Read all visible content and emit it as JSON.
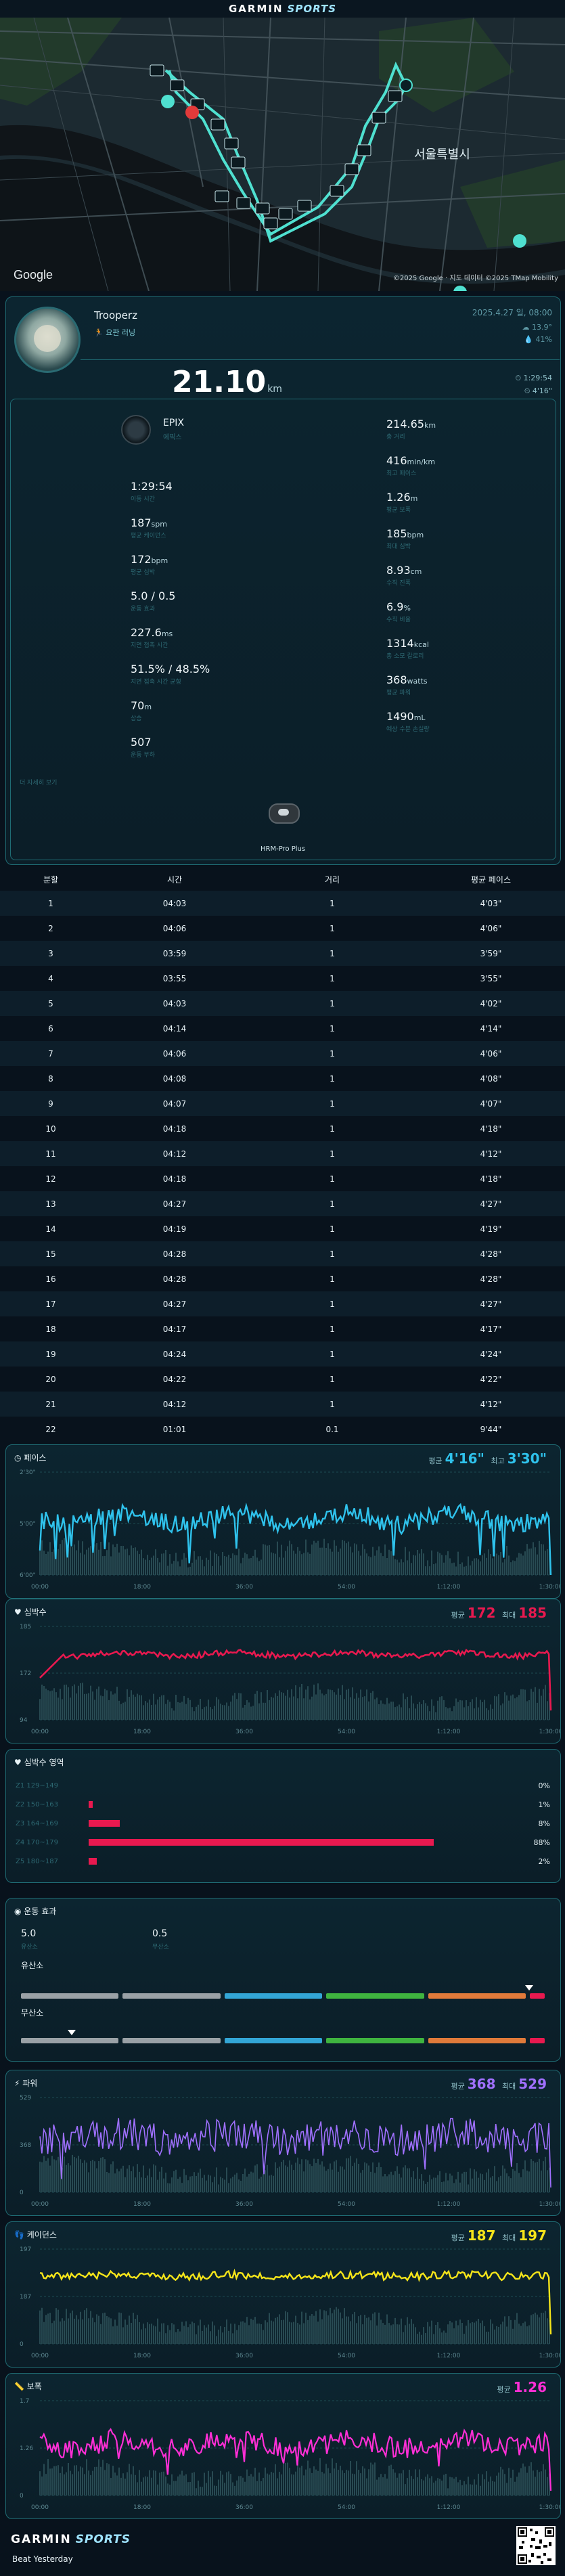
{
  "header": {
    "brand": "GARMIN",
    "sub_brand": "SPORTS"
  },
  "map": {
    "google_label": "Google",
    "attribution": "©2025 Google · 지도 데이터 ©2025 TMap Mobility",
    "city_label": "서울특별시",
    "km_markers": [
      "19",
      "20",
      "18",
      "17",
      "16",
      "15",
      "14",
      "13",
      "12",
      "11",
      "10",
      "9",
      "8",
      "7",
      "6",
      "5",
      "4",
      "3",
      "2",
      "1"
    ],
    "route_color": "#4fe0d0"
  },
  "profile": {
    "user_name": "Trooperz",
    "activity_name": "🏃 요판 러닝",
    "date": "2025.4.27 일, 08:00",
    "temperature": "13.9°",
    "humidity": "41%",
    "distance_value": "21.10",
    "distance_unit": "km",
    "total_time": "1:29:54",
    "avg_pace": "4'16\""
  },
  "device": {
    "name": "EPIX",
    "sub": "에픽스"
  },
  "stats": {
    "left": [
      {
        "value": "1:29:54",
        "unit": "",
        "label": "이동 시간"
      },
      {
        "value": "187",
        "unit": "spm",
        "label": "평균 케이던스"
      },
      {
        "value": "172",
        "unit": "bpm",
        "label": "평균 심박"
      },
      {
        "value": "5.0 / 0.5",
        "unit": "",
        "label": "운동 효과"
      },
      {
        "value": "227.6",
        "unit": "ms",
        "label": "지면 접촉 시간"
      },
      {
        "value": "51.5% / 48.5%",
        "unit": "",
        "label": "지면 접촉 시간 균형"
      },
      {
        "value": "70",
        "unit": "m",
        "label": "상승"
      },
      {
        "value": "507",
        "unit": "",
        "label": "운동 부하"
      }
    ],
    "right": [
      {
        "value": "214.65",
        "unit": "km",
        "label": "총 거리"
      },
      {
        "value": "416",
        "unit": "min/km",
        "label": "최고 페이스"
      },
      {
        "value": "1.26",
        "unit": "m",
        "label": "평균 보폭"
      },
      {
        "value": "185",
        "unit": "bpm",
        "label": "최대 심박"
      },
      {
        "value": "8.93",
        "unit": "cm",
        "label": "수직 진폭"
      },
      {
        "value": "6.9",
        "unit": "%",
        "label": "수직 비율"
      },
      {
        "value": "1314",
        "unit": "kcal",
        "label": "총 소모 칼로리"
      },
      {
        "value": "368",
        "unit": "watts",
        "label": "평균 파워"
      },
      {
        "value": "1490",
        "unit": "mL",
        "label": "예상 수분 손실량"
      }
    ],
    "more_label": "더 자세히 보기",
    "sensor_name": "HRM-Pro Plus"
  },
  "splits": {
    "headers": [
      "분할",
      "시간",
      "거리",
      "평균 페이스"
    ],
    "rows": [
      [
        "1",
        "04:03",
        "1",
        "4'03\""
      ],
      [
        "2",
        "04:06",
        "1",
        "4'06\""
      ],
      [
        "3",
        "03:59",
        "1",
        "3'59\""
      ],
      [
        "4",
        "03:55",
        "1",
        "3'55\""
      ],
      [
        "5",
        "04:03",
        "1",
        "4'02\""
      ],
      [
        "6",
        "04:14",
        "1",
        "4'14\""
      ],
      [
        "7",
        "04:06",
        "1",
        "4'06\""
      ],
      [
        "8",
        "04:08",
        "1",
        "4'08\""
      ],
      [
        "9",
        "04:07",
        "1",
        "4'07\""
      ],
      [
        "10",
        "04:18",
        "1",
        "4'18\""
      ],
      [
        "11",
        "04:12",
        "1",
        "4'12\""
      ],
      [
        "12",
        "04:18",
        "1",
        "4'18\""
      ],
      [
        "13",
        "04:27",
        "1",
        "4'27\""
      ],
      [
        "14",
        "04:19",
        "1",
        "4'19\""
      ],
      [
        "15",
        "04:28",
        "1",
        "4'28\""
      ],
      [
        "16",
        "04:28",
        "1",
        "4'28\""
      ],
      [
        "17",
        "04:27",
        "1",
        "4'27\""
      ],
      [
        "18",
        "04:17",
        "1",
        "4'17\""
      ],
      [
        "19",
        "04:24",
        "1",
        "4'24\""
      ],
      [
        "20",
        "04:22",
        "1",
        "4'22\""
      ],
      [
        "21",
        "04:12",
        "1",
        "4'12\""
      ],
      [
        "22",
        "01:01",
        "0.1",
        "9'44\""
      ]
    ]
  },
  "x_ticks": [
    "00:00",
    "18:00",
    "36:00",
    "54:00",
    "1:12:00",
    "1:30:00"
  ],
  "cards": {
    "pace": {
      "title": "페이스",
      "avg_label": "평균",
      "avg": "4'16\"",
      "max_label": "최고",
      "max": "3'30\"",
      "y_ticks": [
        "2'30\"",
        "5'00\"",
        "6'00\""
      ],
      "color": "#2fc2ec"
    },
    "hr": {
      "title": "심박수",
      "avg_label": "평균",
      "avg": "172",
      "max_label": "최대",
      "max": "185",
      "y_ticks": [
        "185",
        "172",
        "94"
      ],
      "color": "#e8194f"
    },
    "zones": {
      "title": "심박수 영역",
      "rows": [
        {
          "label": "Z1 129~149",
          "pct": "0%",
          "frac": 0.0
        },
        {
          "label": "Z2 150~163",
          "pct": "1%",
          "frac": 0.01
        },
        {
          "label": "Z3 164~169",
          "pct": "8%",
          "frac": 0.08
        },
        {
          "label": "Z4 170~179",
          "pct": "88%",
          "frac": 0.88
        },
        {
          "label": "Z5 180~187",
          "pct": "2%",
          "frac": 0.02
        }
      ],
      "color": "#e8194f"
    },
    "effect": {
      "title": "운동 효과",
      "aerobic_value": "5.0",
      "aerobic_label": "유산소",
      "anaerobic_value": "0.5",
      "anaerobic_label": "무산소",
      "aerobic_level": 5.0,
      "anaerobic_level": 0.5,
      "segment_colors": [
        "#9aa1a6",
        "#9aa1a6",
        "#33a6d6",
        "#3fb43f",
        "#e07a3a",
        "#e8194f"
      ]
    },
    "power": {
      "title": "파워",
      "avg_label": "평균",
      "avg": "368",
      "max_label": "최대",
      "max": "529",
      "y_ticks": [
        "529",
        "368",
        "0"
      ],
      "color": "#a070ff"
    },
    "cadence": {
      "title": "케이던스",
      "avg_label": "평균",
      "avg": "187",
      "max_label": "최대",
      "max": "197",
      "y_ticks": [
        "197",
        "187",
        "0"
      ],
      "color": "#f6e51a"
    },
    "stride": {
      "title": "보폭",
      "avg_label": "평균",
      "avg": "1.26",
      "y_ticks": [
        "1.7",
        "1.26",
        "0"
      ],
      "color": "#ff2fd6"
    }
  },
  "footer": {
    "brand": "GARMIN",
    "sub_brand": "SPORTS",
    "slogan": "Beat Yesterday"
  }
}
